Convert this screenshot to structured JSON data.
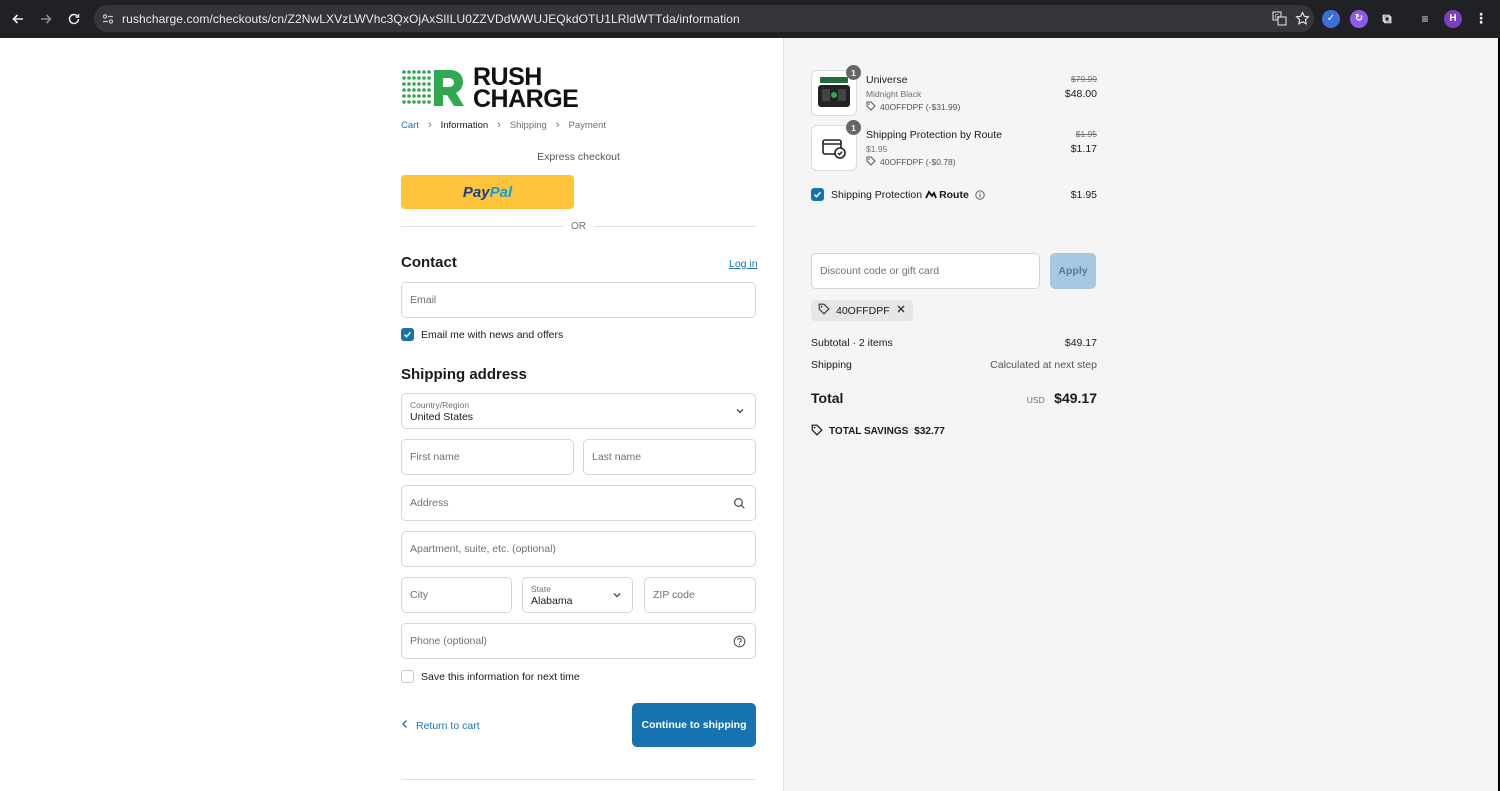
{
  "browser": {
    "url": "rushcharge.com/checkouts/cn/Z2NwLXVzLWVhc3QxOjAxSlILU0ZZVDdWWUJEQkdOTU1LRldWTTda/information",
    "profile_initial": "H"
  },
  "brand": {
    "line1": "RUSH",
    "line2": "CHARGE",
    "green": "#2fa84f",
    "blue": "#1773b0"
  },
  "breadcrumb": [
    "Cart",
    "Information",
    "Shipping",
    "Payment"
  ],
  "express": {
    "label": "Express checkout",
    "paypal_pay": "Pay",
    "paypal_pal": "Pal",
    "or": "OR"
  },
  "contact": {
    "title": "Contact",
    "login": "Log in",
    "email_placeholder": "Email",
    "news_label": "Email me with news and offers",
    "news_checked": true
  },
  "shipping": {
    "title": "Shipping address",
    "country_label": "Country/Region",
    "country_value": "United States",
    "first_name": "First name",
    "last_name": "Last name",
    "address": "Address",
    "apartment": "Apartment, suite, etc. (optional)",
    "city": "City",
    "state_label": "State",
    "state_value": "Alabama",
    "zip": "ZIP code",
    "phone": "Phone (optional)",
    "save_label": "Save this information for next time",
    "save_checked": false
  },
  "actions": {
    "return": "Return to cart",
    "continue": "Continue to shipping"
  },
  "summary": {
    "items": [
      {
        "qty": "1",
        "name": "Universe",
        "variant": "Midnight Black",
        "discount": "40OFFDPF (-$31.99)",
        "old_price": "$79.99",
        "price": "$48.00"
      },
      {
        "qty": "1",
        "name": "Shipping Protection by Route",
        "variant": "$1.95",
        "discount": "40OFFDPF (-$0.78)",
        "old_price": "$1.95",
        "price": "$1.17"
      }
    ],
    "route": {
      "label": "Shipping Protection",
      "brand": "Route",
      "price": "$1.95",
      "checked": true
    },
    "discount_placeholder": "Discount code or gift card",
    "apply": "Apply",
    "applied_code": "40OFFDPF",
    "subtotal_label": "Subtotal · 2 items",
    "subtotal_value": "$49.17",
    "shipping_label": "Shipping",
    "shipping_value": "Calculated at next step",
    "total_label": "Total",
    "currency": "USD",
    "total_value": "$49.17",
    "savings_label": "TOTAL SAVINGS",
    "savings_value": "$32.77"
  }
}
